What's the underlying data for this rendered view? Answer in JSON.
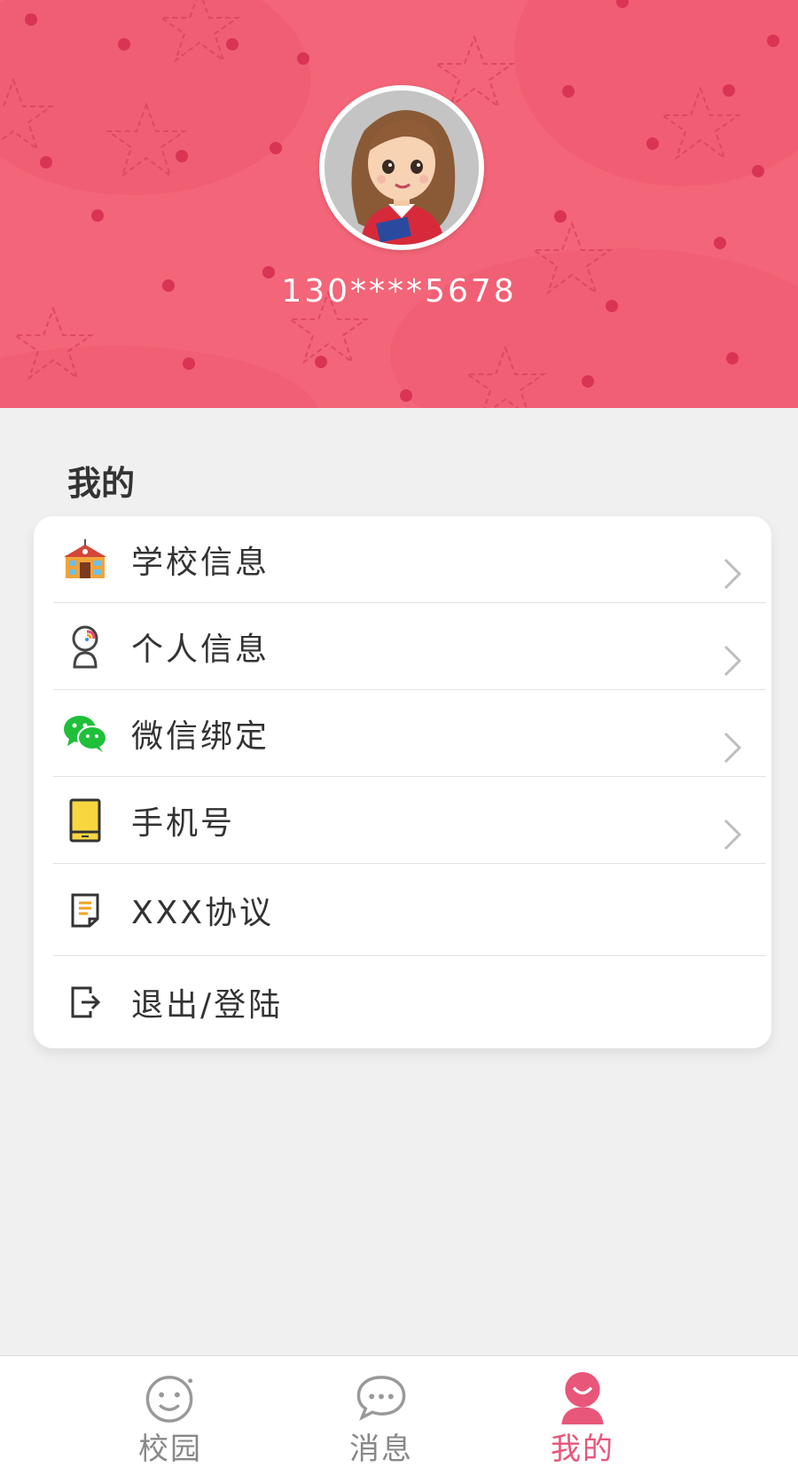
{
  "profile": {
    "phone": "130****5678",
    "avatar_icon": "avatar-girl-icon"
  },
  "section": {
    "title": "我的"
  },
  "menu": [
    {
      "label": "学校信息",
      "icon": "school-icon",
      "has_chevron": true
    },
    {
      "label": "个人信息",
      "icon": "personal-info-icon",
      "has_chevron": true
    },
    {
      "label": "微信绑定",
      "icon": "wechat-icon",
      "has_chevron": true
    },
    {
      "label": "手机号",
      "icon": "phone-icon",
      "has_chevron": true
    },
    {
      "label": "XXX协议",
      "icon": "agreement-icon",
      "has_chevron": false
    },
    {
      "label": "退出/登陆",
      "icon": "logout-icon",
      "has_chevron": false
    }
  ],
  "tabs": [
    {
      "label": "校园",
      "icon": "smile-face-icon",
      "active": false
    },
    {
      "label": "消息",
      "icon": "chat-bubble-icon",
      "active": false
    },
    {
      "label": "我的",
      "icon": "person-icon",
      "active": true
    }
  ],
  "colors": {
    "header_bg": "#f36578",
    "accent": "#e8567a",
    "inactive_tab": "#888888"
  }
}
